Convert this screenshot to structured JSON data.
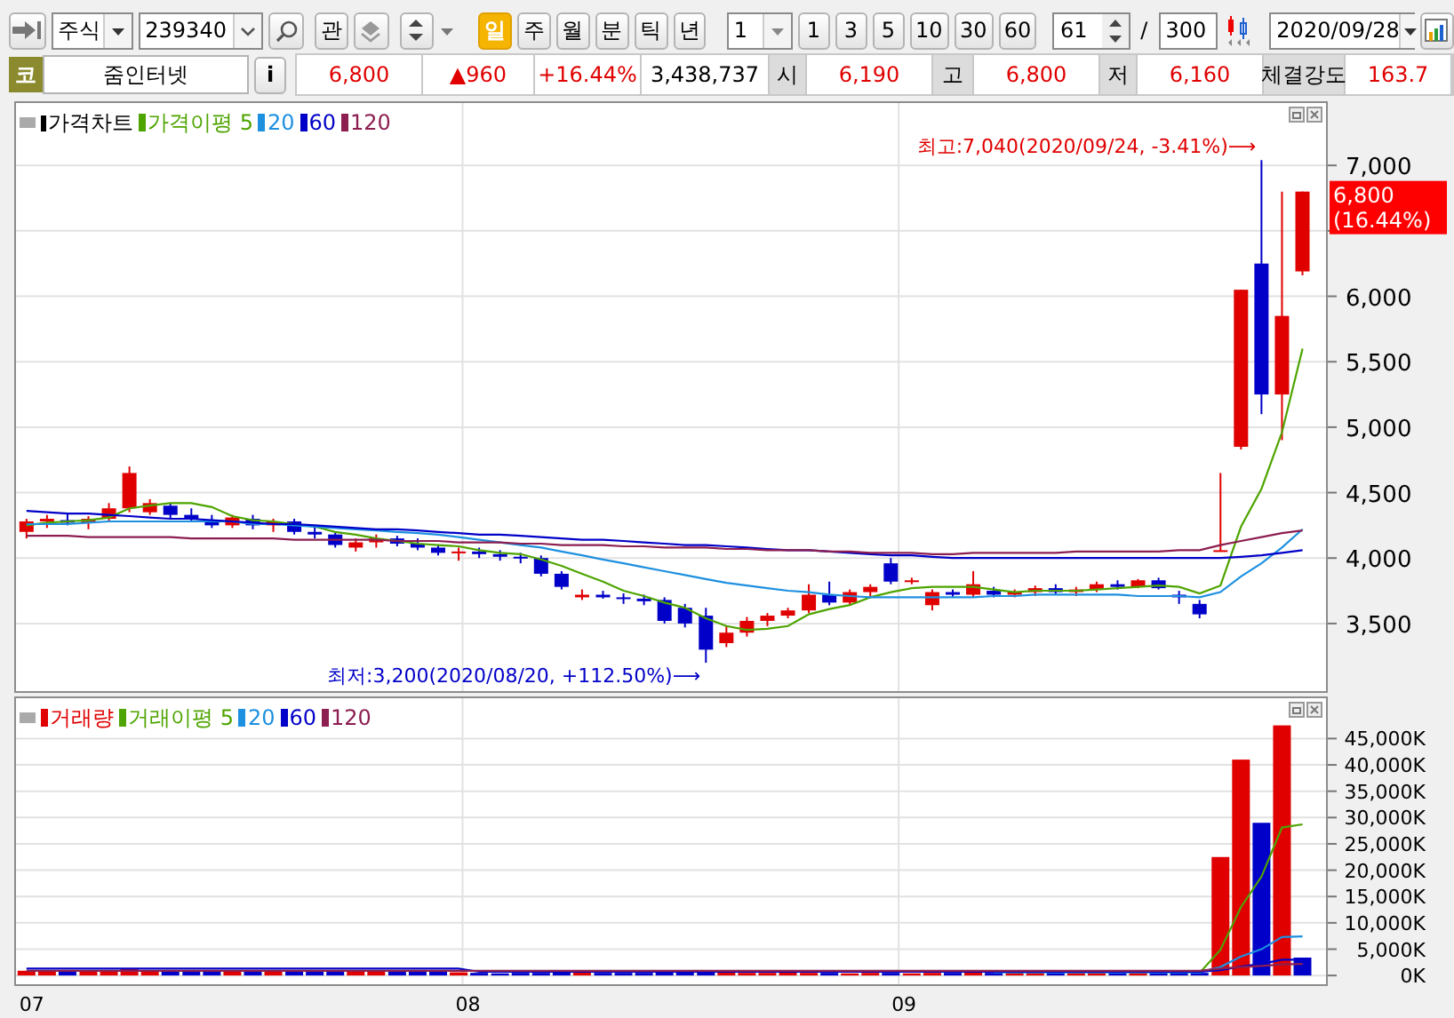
{
  "toolbar": {
    "market": {
      "value": "주식"
    },
    "code": {
      "value": "239340"
    },
    "watch_button": "관",
    "periods": [
      {
        "label": "일",
        "selected": true
      },
      {
        "label": "주",
        "selected": false
      },
      {
        "label": "월",
        "selected": false
      },
      {
        "label": "분",
        "selected": false
      },
      {
        "label": "틱",
        "selected": false
      },
      {
        "label": "년",
        "selected": false
      }
    ],
    "interval": {
      "value": "1"
    },
    "intervals": [
      "1",
      "3",
      "5",
      "10",
      "30",
      "60"
    ],
    "count": {
      "value": "61"
    },
    "separator": "/",
    "total": {
      "value": "300"
    },
    "date": {
      "value": "2020/09/28"
    }
  },
  "quote": {
    "market_badge": "코",
    "name": "줌인터넷",
    "info_button": "i",
    "price": "6,800",
    "change": "▲960",
    "change_rate": "+16.44%",
    "volume": "3,438,737",
    "fields": [
      {
        "label": "시",
        "value": "6,190"
      },
      {
        "label": "고",
        "value": "6,800"
      },
      {
        "label": "저",
        "value": "6,160"
      },
      {
        "label": "체결강도",
        "value": "163.7"
      }
    ]
  },
  "price_chart": {
    "current_price": {
      "value": "6,800",
      "change": "(16.44%)"
    },
    "chart_data": {
      "type": "candlestick",
      "title": "가격차트",
      "legend": "upper left",
      "grid": true,
      "ylim": [
        2970,
        7490
      ],
      "yticks": [
        {
          "value": 3500,
          "label": "3,500"
        },
        {
          "value": 4000,
          "label": "4,000"
        },
        {
          "value": 4500,
          "label": "4,500"
        },
        {
          "value": 5000,
          "label": "5,000"
        },
        {
          "value": 5500,
          "label": "5,500"
        },
        {
          "value": 6000,
          "label": "6,000"
        },
        {
          "value": 7000,
          "label": "7,000"
        }
      ],
      "xlim": [
        6.98,
        9.98
      ],
      "x": [
        7,
        7.047,
        7.094,
        7.142,
        7.189,
        7.236,
        7.283,
        7.33,
        7.378,
        7.425,
        7.472,
        7.519,
        7.566,
        7.614,
        7.661,
        7.708,
        7.755,
        7.802,
        7.85,
        7.897,
        7.944,
        7.991,
        8.038,
        8.086,
        8.133,
        8.18,
        8.227,
        8.274,
        8.322,
        8.369,
        8.416,
        8.463,
        8.51,
        8.558,
        8.605,
        8.652,
        8.699,
        8.746,
        8.794,
        8.841,
        8.888,
        8.935,
        8.982,
        9.03,
        9.077,
        9.124,
        9.171,
        9.218,
        9.266,
        9.313,
        9.36,
        9.407,
        9.454,
        9.502,
        9.549,
        9.596,
        9.643,
        9.69,
        9.738,
        9.785,
        9.832,
        9.879,
        9.926
      ],
      "ohlc": [
        [
          4200,
          4300,
          4150,
          4280
        ],
        [
          4280,
          4330,
          4230,
          4300
        ],
        [
          4290,
          4340,
          4250,
          4270
        ],
        [
          4270,
          4320,
          4220,
          4300
        ],
        [
          4300,
          4420,
          4280,
          4380
        ],
        [
          4380,
          4700,
          4350,
          4650
        ],
        [
          4350,
          4450,
          4330,
          4420
        ],
        [
          4400,
          4420,
          4300,
          4330
        ],
        [
          4330,
          4380,
          4280,
          4300
        ],
        [
          4280,
          4330,
          4230,
          4250
        ],
        [
          4250,
          4330,
          4230,
          4310
        ],
        [
          4300,
          4330,
          4220,
          4250
        ],
        [
          4250,
          4300,
          4200,
          4280
        ],
        [
          4280,
          4300,
          4180,
          4200
        ],
        [
          4200,
          4250,
          4150,
          4180
        ],
        [
          4180,
          4200,
          4080,
          4100
        ],
        [
          4080,
          4150,
          4050,
          4120
        ],
        [
          4120,
          4180,
          4080,
          4150
        ],
        [
          4150,
          4170,
          4090,
          4110
        ],
        [
          4110,
          4150,
          4060,
          4080
        ],
        [
          4080,
          4100,
          4020,
          4040
        ],
        [
          4040,
          4080,
          3980,
          4050
        ],
        [
          4050,
          4080,
          4000,
          4030
        ],
        [
          4030,
          4060,
          3980,
          4010
        ],
        [
          4010,
          4040,
          3960,
          4000
        ],
        [
          4000,
          4020,
          3860,
          3880
        ],
        [
          3880,
          3900,
          3760,
          3780
        ],
        [
          3700,
          3760,
          3680,
          3720
        ],
        [
          3720,
          3750,
          3690,
          3700
        ],
        [
          3700,
          3730,
          3650,
          3690
        ],
        [
          3690,
          3720,
          3640,
          3670
        ],
        [
          3680,
          3700,
          3500,
          3520
        ],
        [
          3620,
          3650,
          3470,
          3500
        ],
        [
          3560,
          3620,
          3200,
          3300
        ],
        [
          3350,
          3480,
          3320,
          3430
        ],
        [
          3430,
          3550,
          3400,
          3520
        ],
        [
          3520,
          3580,
          3480,
          3560
        ],
        [
          3560,
          3620,
          3540,
          3600
        ],
        [
          3600,
          3800,
          3580,
          3720
        ],
        [
          3720,
          3820,
          3640,
          3660
        ],
        [
          3660,
          3760,
          3640,
          3740
        ],
        [
          3740,
          3800,
          3700,
          3780
        ],
        [
          3960,
          4000,
          3800,
          3820
        ],
        [
          3820,
          3850,
          3800,
          3830
        ],
        [
          3640,
          3760,
          3600,
          3740
        ],
        [
          3740,
          3760,
          3700,
          3720
        ],
        [
          3720,
          3900,
          3700,
          3800
        ],
        [
          3750,
          3780,
          3700,
          3720
        ],
        [
          3720,
          3760,
          3700,
          3740
        ],
        [
          3740,
          3790,
          3710,
          3770
        ],
        [
          3770,
          3800,
          3720,
          3740
        ],
        [
          3740,
          3780,
          3710,
          3760
        ],
        [
          3760,
          3820,
          3740,
          3800
        ],
        [
          3800,
          3830,
          3760,
          3780
        ],
        [
          3780,
          3840,
          3770,
          3830
        ],
        [
          3830,
          3850,
          3760,
          3770
        ],
        [
          3720,
          3750,
          3650,
          3700
        ],
        [
          3650,
          3680,
          3540,
          3570
        ],
        [
          4050,
          4650,
          4050,
          4060
        ],
        [
          4850,
          6050,
          4830,
          6050
        ],
        [
          6250,
          7040,
          5100,
          5250
        ],
        [
          5250,
          6800,
          4900,
          5850
        ],
        [
          6190,
          6800,
          6160,
          6800
        ]
      ],
      "series": [
        {
          "name": "가격이평 5",
          "type": "line",
          "color": "#4ea400",
          "values": [
            4250,
            4270,
            4280,
            4290,
            4310,
            4380,
            4400,
            4420,
            4420,
            4390,
            4320,
            4290,
            4280,
            4260,
            4240,
            4200,
            4180,
            4150,
            4130,
            4110,
            4100,
            4090,
            4060,
            4040,
            4030,
            3990,
            3940,
            3880,
            3820,
            3750,
            3710,
            3660,
            3620,
            3540,
            3480,
            3450,
            3460,
            3480,
            3570,
            3610,
            3640,
            3700,
            3740,
            3770,
            3780,
            3780,
            3780,
            3760,
            3740,
            3750,
            3750,
            3750,
            3760,
            3770,
            3780,
            3790,
            3780,
            3730,
            3790,
            4240,
            4530,
            4960,
            5600
          ]
        },
        {
          "name": "20",
          "type": "line",
          "color": "#1e90e0",
          "values": [
            4260,
            4260,
            4260,
            4270,
            4280,
            4280,
            4280,
            4280,
            4280,
            4280,
            4280,
            4260,
            4260,
            4250,
            4240,
            4230,
            4220,
            4210,
            4200,
            4190,
            4180,
            4160,
            4140,
            4120,
            4100,
            4080,
            4050,
            4020,
            3990,
            3960,
            3930,
            3900,
            3870,
            3840,
            3810,
            3790,
            3770,
            3750,
            3740,
            3720,
            3710,
            3700,
            3700,
            3700,
            3700,
            3700,
            3700,
            3710,
            3710,
            3720,
            3720,
            3720,
            3720,
            3720,
            3710,
            3710,
            3710,
            3700,
            3740,
            3860,
            3960,
            4080,
            4220
          ]
        },
        {
          "name": "60",
          "type": "line",
          "color": "#0000c8",
          "values": [
            4360,
            4350,
            4340,
            4340,
            4330,
            4320,
            4310,
            4300,
            4300,
            4290,
            4280,
            4270,
            4260,
            4260,
            4250,
            4240,
            4230,
            4220,
            4220,
            4210,
            4200,
            4190,
            4180,
            4180,
            4170,
            4160,
            4150,
            4140,
            4140,
            4130,
            4120,
            4110,
            4100,
            4100,
            4090,
            4080,
            4070,
            4060,
            4060,
            4050,
            4040,
            4030,
            4020,
            4020,
            4010,
            4000,
            4000,
            4000,
            4000,
            4000,
            4000,
            4000,
            4000,
            4000,
            4000,
            4000,
            4000,
            4000,
            4000,
            4010,
            4020,
            4040,
            4060
          ]
        },
        {
          "name": "120",
          "type": "line",
          "color": "#8c1e50",
          "values": [
            4170,
            4170,
            4170,
            4160,
            4160,
            4160,
            4160,
            4160,
            4150,
            4150,
            4150,
            4150,
            4150,
            4140,
            4140,
            4140,
            4140,
            4140,
            4130,
            4130,
            4130,
            4120,
            4120,
            4120,
            4110,
            4110,
            4100,
            4100,
            4100,
            4090,
            4090,
            4080,
            4080,
            4080,
            4070,
            4070,
            4060,
            4060,
            4060,
            4050,
            4050,
            4040,
            4040,
            4040,
            4030,
            4030,
            4040,
            4040,
            4040,
            4040,
            4040,
            4050,
            4050,
            4050,
            4050,
            4050,
            4060,
            4060,
            4100,
            4130,
            4160,
            4190,
            4210
          ]
        }
      ],
      "annotations": [
        "최고:7,040(2020/09/24, -3.41%)⟶",
        "최저:3,200(2020/08/20, +112.50%)⟶"
      ]
    }
  },
  "volume_chart": {
    "chart_data": {
      "type": "bar",
      "legend": "upper left",
      "grid": true,
      "ylim": [
        -2000,
        53000
      ],
      "yticks": [
        {
          "value": 0,
          "label": "0K"
        },
        {
          "value": 5000,
          "label": "5,000K"
        },
        {
          "value": 10000,
          "label": "10,000K"
        },
        {
          "value": 15000,
          "label": "15,000K"
        },
        {
          "value": 20000,
          "label": "20,000K"
        },
        {
          "value": 25000,
          "label": "25,000K"
        },
        {
          "value": 30000,
          "label": "30,000K"
        },
        {
          "value": 35000,
          "label": "35,000K"
        },
        {
          "value": 40000,
          "label": "40,000K"
        },
        {
          "value": 45000,
          "label": "45,000K"
        }
      ],
      "x": [
        7,
        7.047,
        7.094,
        7.142,
        7.189,
        7.236,
        7.283,
        7.33,
        7.378,
        7.425,
        7.472,
        7.519,
        7.566,
        7.614,
        7.661,
        7.708,
        7.755,
        7.802,
        7.85,
        7.897,
        7.944,
        7.991,
        8.038,
        8.086,
        8.133,
        8.18,
        8.227,
        8.274,
        8.322,
        8.369,
        8.416,
        8.463,
        8.51,
        8.558,
        8.605,
        8.652,
        8.699,
        8.746,
        8.794,
        8.841,
        8.888,
        8.935,
        8.982,
        9.03,
        9.077,
        9.124,
        9.171,
        9.218,
        9.266,
        9.313,
        9.36,
        9.407,
        9.454,
        9.502,
        9.549,
        9.596,
        9.643,
        9.69,
        9.738,
        9.785,
        9.832,
        9.879,
        9.926
      ],
      "xlim": [
        6.98,
        9.98
      ],
      "xticks": [
        {
          "value": 7,
          "label": "07"
        },
        {
          "value": 8,
          "label": "08"
        },
        {
          "value": 9,
          "label": "09"
        }
      ],
      "series": [
        {
          "name": "거래량",
          "type": "bar",
          "color": "#e00000",
          "values": [
            900,
            700,
            null,
            800,
            1000,
            1200,
            900,
            null,
            null,
            null,
            800,
            null,
            800,
            null,
            null,
            null,
            700,
            800,
            null,
            null,
            null,
            600,
            null,
            null,
            null,
            null,
            null,
            600,
            null,
            null,
            null,
            null,
            null,
            null,
            600,
            500,
            500,
            600,
            500,
            null,
            400,
            500,
            null,
            400,
            500,
            null,
            600,
            null,
            500,
            500,
            null,
            500,
            500,
            null,
            500,
            null,
            null,
            null,
            22500,
            41000,
            null,
            47500,
            null
          ]
        },
        {
          "type": "bar",
          "color": "#0000c8",
          "values": [
            null,
            null,
            900,
            null,
            null,
            null,
            null,
            800,
            800,
            700,
            null,
            700,
            null,
            700,
            800,
            900,
            null,
            null,
            700,
            800,
            700,
            null,
            500,
            400,
            500,
            500,
            600,
            null,
            500,
            500,
            500,
            600,
            700,
            800,
            null,
            null,
            null,
            null,
            null,
            500,
            null,
            null,
            500,
            null,
            null,
            500,
            null,
            500,
            null,
            null,
            500,
            null,
            null,
            500,
            null,
            500,
            600,
            500,
            null,
            null,
            29000,
            null,
            3400
          ]
        },
        {
          "name": "거래이평 5",
          "type": "line",
          "color": "#4ea400",
          "values": [
            null,
            null,
            null,
            null,
            null,
            null,
            null,
            null,
            null,
            null,
            null,
            null,
            null,
            null,
            null,
            null,
            null,
            null,
            null,
            null,
            null,
            null,
            null,
            null,
            null,
            null,
            null,
            null,
            null,
            null,
            null,
            null,
            null,
            null,
            null,
            null,
            null,
            null,
            null,
            null,
            null,
            null,
            null,
            null,
            null,
            null,
            null,
            null,
            null,
            null,
            null,
            null,
            null,
            null,
            null,
            null,
            null,
            500,
            4900,
            13000,
            18800,
            28100,
            28700
          ]
        },
        {
          "name": "20",
          "type": "line",
          "color": "#1e90e0",
          "values": [
            null,
            null,
            null,
            null,
            null,
            null,
            null,
            null,
            null,
            null,
            null,
            null,
            null,
            null,
            null,
            null,
            null,
            null,
            null,
            null,
            null,
            null,
            null,
            null,
            null,
            null,
            null,
            null,
            null,
            null,
            null,
            null,
            null,
            null,
            null,
            null,
            null,
            null,
            null,
            null,
            null,
            null,
            null,
            null,
            null,
            null,
            null,
            600,
            600,
            600,
            600,
            600,
            600,
            600,
            600,
            600,
            600,
            600,
            1600,
            3600,
            5000,
            7300,
            7400
          ]
        },
        {
          "name": "60",
          "type": "line",
          "color": "#0000c8",
          "values": [
            1300,
            1300,
            1300,
            1300,
            1300,
            1300,
            1300,
            1300,
            1300,
            1300,
            1300,
            1300,
            1300,
            1300,
            1300,
            1300,
            1300,
            1300,
            1300,
            1300,
            1300,
            1300,
            700,
            700,
            700,
            700,
            700,
            700,
            700,
            700,
            700,
            700,
            700,
            700,
            700,
            700,
            700,
            700,
            700,
            700,
            700,
            700,
            700,
            700,
            700,
            700,
            700,
            700,
            700,
            700,
            700,
            700,
            700,
            700,
            700,
            700,
            700,
            700,
            1000,
            1700,
            2200,
            3000,
            3000
          ]
        },
        {
          "name": "120",
          "type": "line",
          "color": "#8c1e50",
          "values": [
            900,
            900,
            900,
            900,
            900,
            900,
            900,
            900,
            900,
            900,
            900,
            900,
            900,
            900,
            900,
            900,
            900,
            900,
            900,
            900,
            900,
            900,
            900,
            900,
            900,
            900,
            900,
            900,
            900,
            900,
            900,
            900,
            900,
            900,
            900,
            900,
            900,
            900,
            900,
            900,
            900,
            900,
            900,
            900,
            900,
            900,
            900,
            900,
            900,
            900,
            900,
            900,
            900,
            900,
            900,
            900,
            900,
            900,
            1300,
            1600,
            1800,
            2100,
            2200
          ]
        }
      ]
    }
  }
}
